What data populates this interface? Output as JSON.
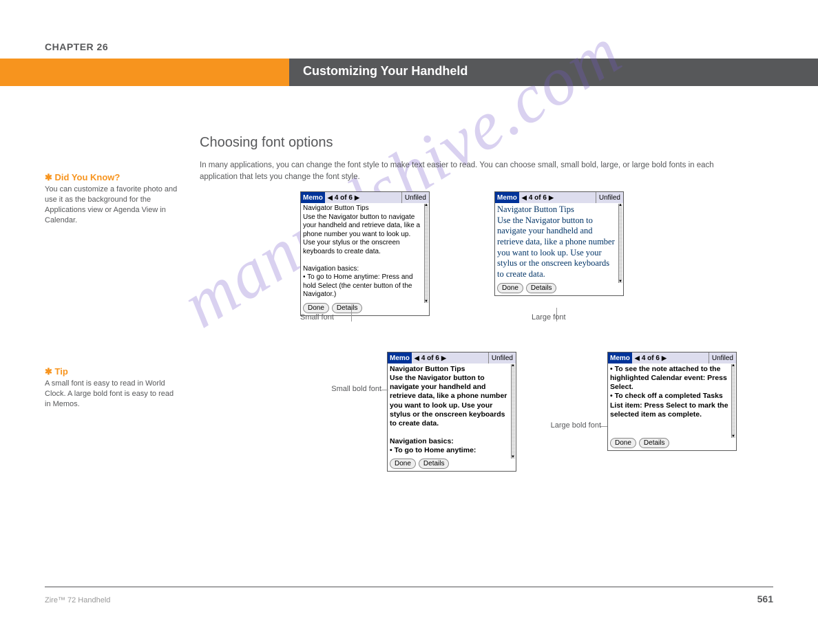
{
  "chapter": {
    "label": "CHAPTER 26",
    "title": "Customizing Your Handheld"
  },
  "section": {
    "title": "Choosing font options",
    "intro": "In many applications, you can change the font style to make text easier to read. You can choose small, small bold, large, or large bold fonts in each application that lets you change the font style."
  },
  "tips": {
    "t1_lead": "Did You Know?",
    "t1_body": "You can customize a favorite photo and use it as the background for the Applications view or Agenda View in Calendar.",
    "t2_lead": "Tip",
    "t2_body": "A small font is easy to read in World Clock. A large bold font is easy to read in Memos."
  },
  "memo": {
    "tag": "Memo",
    "page": "4 of 6",
    "category": "Unfiled",
    "done": "Done",
    "details": "Details",
    "body_small": "Navigator Button Tips\nUse the Navigator button to navigate your handheld and retrieve data, like a phone number you want to look up. Use your stylus or the onscreen keyboards to create data.\n\nNavigation basics:\n• To go to Home anytime: Press and hold Select (the center button of the Navigator.)",
    "body_large": "Navigator Button Tips\nUse the Navigator button to navigate your handheld and retrieve data, like a phone number you want to look up. Use your stylus or the onscreen keyboards to create data.",
    "body_smallbold": "Navigator Button Tips\nUse the Navigator button to navigate your handheld and retrieve data, like a phone number you want to look up. Use your stylus or the onscreen keyboards to create data.\n\nNavigation basics:\n• To go to Home anytime:",
    "body_largebold": "• To see the note attached to the highlighted Calendar event: Press Select.\n• To check off a completed Tasks List item: Press Select to mark the selected item as complete."
  },
  "captions": {
    "c1": "Small font",
    "c2": "Large font",
    "c3": "Small bold font",
    "c4": "Large bold font"
  },
  "footer": {
    "left": "Zire™ 72 Handheld",
    "right": "561"
  },
  "watermark": "manualshive.com"
}
